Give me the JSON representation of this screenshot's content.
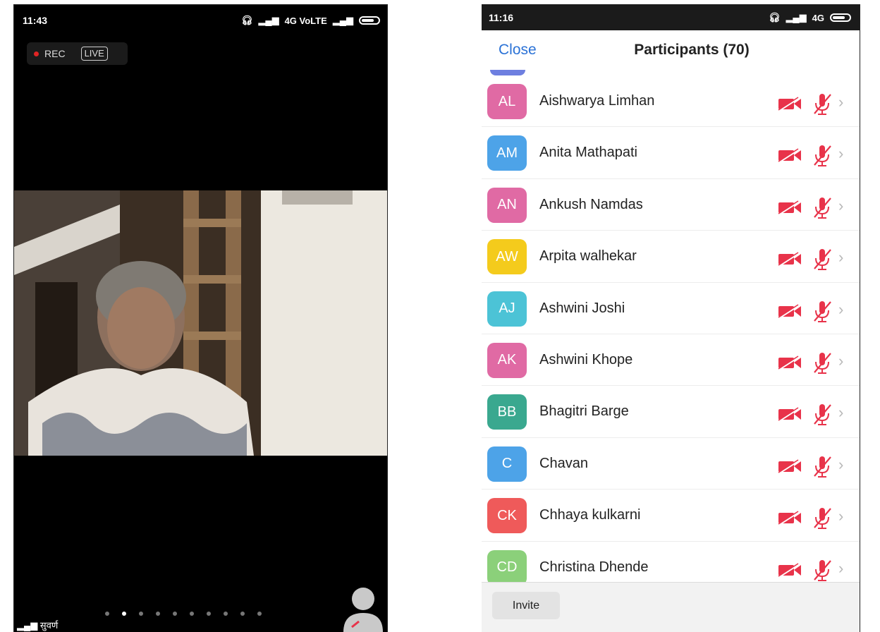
{
  "left_phone": {
    "time": "11:43",
    "network": "4G VoLTE",
    "rec_label": "REC",
    "live_label": "LIVE",
    "carrier": "सुवर्ण",
    "page_dots": 10,
    "active_dot": 2
  },
  "right_phone": {
    "time": "11:16",
    "network": "4G",
    "close_label": "Close",
    "title": "Participants (70)",
    "invite_label": "Invite",
    "participants": [
      {
        "initials": "AL",
        "name": "Aishwarya Limhan",
        "color": "#e06aa4"
      },
      {
        "initials": "AM",
        "name": "Anita Mathapati",
        "color": "#4da3e8"
      },
      {
        "initials": "AN",
        "name": "Ankush Namdas",
        "color": "#e06aa4"
      },
      {
        "initials": "AW",
        "name": "Arpita walhekar",
        "color": "#f4cb1c"
      },
      {
        "initials": "AJ",
        "name": "Ashwini Joshi",
        "color": "#4cc3d6"
      },
      {
        "initials": "AK",
        "name": "Ashwini Khope",
        "color": "#e06aa4"
      },
      {
        "initials": "BB",
        "name": "Bhagitri Barge",
        "color": "#3aa88f"
      },
      {
        "initials": "C",
        "name": "Chavan",
        "color": "#4da3e8"
      },
      {
        "initials": "CK",
        "name": "Chhaya kulkarni",
        "color": "#ef5a5a"
      },
      {
        "initials": "CD",
        "name": "Christina Dhende",
        "color": "#8bd07a"
      }
    ],
    "muted_color": "#e8334a"
  }
}
